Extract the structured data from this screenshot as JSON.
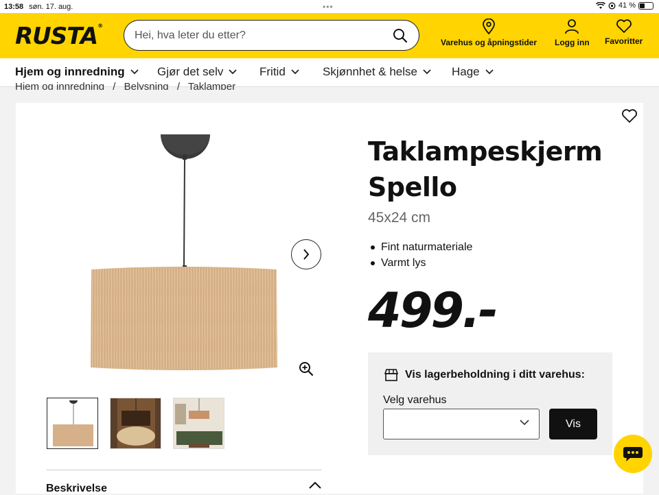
{
  "status_bar": {
    "time": "13:58",
    "date": "søn. 17. aug.",
    "battery": "41 %",
    "battery_level": 0.41
  },
  "header": {
    "logo": "RUSTA",
    "search_placeholder": "Hei, hva leter du etter?",
    "actions": [
      {
        "label": "Varehus og åpningstider",
        "icon": "location-pin-icon"
      },
      {
        "label": "Logg inn",
        "icon": "user-icon"
      },
      {
        "label": "Favoritter",
        "icon": "heart-icon"
      }
    ]
  },
  "nav": [
    {
      "label": "Hjem og innredning"
    },
    {
      "label": "Gjør det selv"
    },
    {
      "label": "Fritid"
    },
    {
      "label": "Skjønnhet & helse"
    },
    {
      "label": "Hage"
    }
  ],
  "breadcrumb": [
    "Hjem og innredning",
    "/",
    "Belysning",
    "/",
    "Taklamper"
  ],
  "product": {
    "title_line1": "Taklampeskjerm",
    "title_line2": "Spello",
    "size": "45x24 cm",
    "bullets": [
      "Fint naturmateriale",
      "Varmt lys"
    ],
    "price": "499.-"
  },
  "stock": {
    "heading": "Vis lagerbeholdning i ditt varehus:",
    "select_label": "Velg varehus",
    "select_value": "",
    "button": "Vis"
  },
  "description": {
    "label": "Beskrivelse"
  },
  "colors": {
    "brand_yellow": "#ffd400",
    "dark": "#111111"
  }
}
